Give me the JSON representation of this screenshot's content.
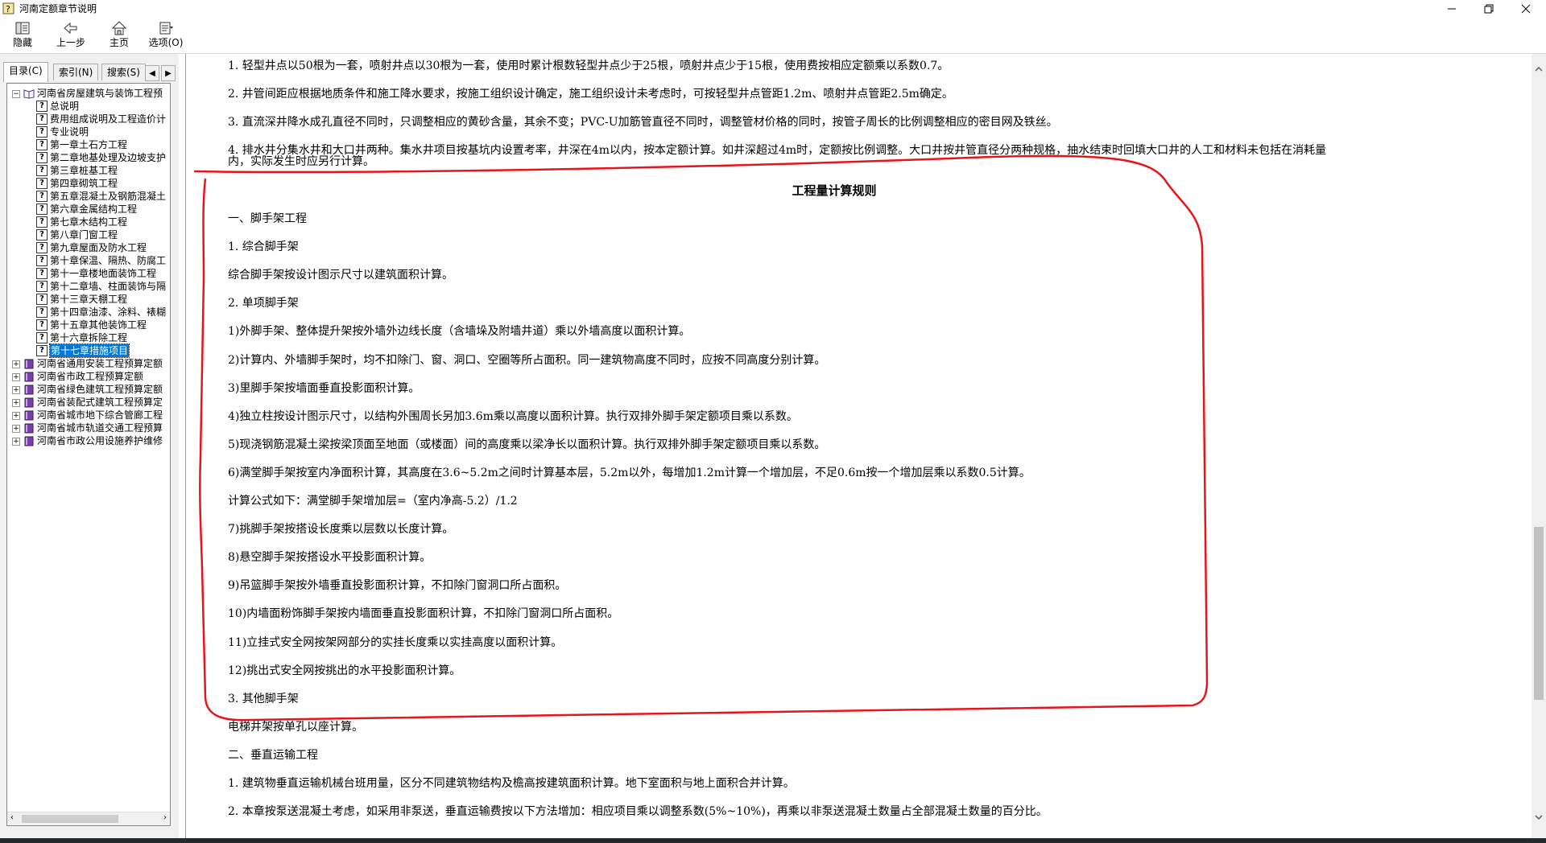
{
  "window": {
    "title": "河南定额章节说明"
  },
  "toolbar": {
    "hide": "隐藏",
    "back": "上一步",
    "home": "主页",
    "options": "选项(O)"
  },
  "tabs": {
    "contents": "目录(C)",
    "index": "索引(N)",
    "search": "搜索(S)"
  },
  "tree": {
    "root": "河南省房屋建筑与装饰工程预",
    "children": [
      "总说明",
      "费用组成说明及工程造价计",
      "专业说明",
      "第一章土石方工程",
      "第二章地基处理及边坡支护",
      "第三章桩基工程",
      "第四章砌筑工程",
      "第五章混凝土及钢筋混凝土",
      "第六章金属结构工程",
      "第七章木结构工程",
      "第八章门窗工程",
      "第九章屋面及防水工程",
      "第十章保温、隔热、防腐工",
      "第十一章楼地面装饰工程",
      "第十二章墙、柱面装饰与隔",
      "第十三章天棚工程",
      "第十四章油漆、涂料、裱糊",
      "第十五章其他装饰工程",
      "第十六章拆除工程",
      "第十七章措施项目"
    ],
    "selected_index": 19,
    "books": [
      "河南省通用安装工程预算定额",
      "河南省市政工程预算定额",
      "河南省绿色建筑工程预算定额",
      "河南省装配式建筑工程预算定",
      "河南省城市地下综合管廊工程",
      "河南省城市轨道交通工程预算",
      "河南省市政公用设施养护维修"
    ]
  },
  "content": {
    "top_items": [
      "1. 轻型井点以50根为一套，喷射井点以30根为一套，使用时累计根数轻型井点少于25根，喷射井点少于15根，使用费按相应定额乘以系数0.7。",
      "2. 井管间距应根据地质条件和施工降水要求，按施工组织设计确定，施工组织设计未考虑时，可按轻型井点管距1.2m、喷射井点管距2.5m确定。",
      "3. 直流深井降水成孔直径不同时，只调整相应的黄砂含量，其余不变；PVC-U加筋管直径不同时，调整管材价格的同时，按管子周长的比例调整相应的密目网及铁丝。"
    ],
    "item4_line1": "4. 排水井分集水井和大口井两种。集水井项目按基坑内设置考率，井深在4m以内，按本定额计算。如井深超过4m时，定额按比例调整。大口井按井管直径分两种规格，抽水结束时回填大口井的人工和材料未包括在消耗量",
    "item4_line2": "内，实际发生时应另行计算。",
    "section_title": "工程量计算规则",
    "lines": [
      "一、脚手架工程",
      "1. 综合脚手架",
      "综合脚手架按设计图示尺寸以建筑面积计算。",
      "2. 单项脚手架",
      "1)外脚手架、整体提升架按外墙外边线长度（含墙垛及附墙井道）乘以外墙高度以面积计算。",
      "2)计算内、外墙脚手架时，均不扣除门、窗、洞口、空圈等所占面积。同一建筑物高度不同时，应按不同高度分别计算。",
      "3)里脚手架按墙面垂直投影面积计算。",
      "4)独立柱按设计图示尺寸，以结构外围周长另加3.6m乘以高度以面积计算。执行双排外脚手架定额项目乘以系数。",
      "5)现浇钢筋混凝土梁按梁顶面至地面（或楼面）间的高度乘以梁净长以面积计算。执行双排外脚手架定额项目乘以系数。",
      "6)满堂脚手架按室内净面积计算，其高度在3.6~5.2m之间时计算基本层，5.2m以外，每增加1.2m计算一个增加层，不足0.6m按一个增加层乘以系数0.5计算。",
      "计算公式如下：满堂脚手架增加层=（室内净高-5.2）/1.2",
      "7)挑脚手架按搭设长度乘以层数以长度计算。",
      "8)悬空脚手架按搭设水平投影面积计算。",
      "9)吊篮脚手架按外墙垂直投影面积计算，不扣除门窗洞口所占面积。",
      "10)内墙面粉饰脚手架按内墙面垂直投影面积计算，不扣除门窗洞口所占面积。",
      "11)立挂式安全网按架网部分的实挂长度乘以实挂高度以面积计算。",
      "12)挑出式安全网按挑出的水平投影面积计算。",
      "3. 其他脚手架",
      "电梯井架按单孔以座计算。",
      "二、垂直运输工程",
      "1. 建筑物垂直运输机械台班用量，区分不同建筑物结构及檐高按建筑面积计算。地下室面积与地上面积合并计算。",
      "2. 本章按泵送混凝土考虑，如采用非泵送，垂直运输费按以下方法增加：相应项目乘以调整系数(5%~10%)，再乘以非泵送混凝土数量占全部混凝土数量的百分比。"
    ]
  },
  "colors": {
    "annotation": "#e8141c",
    "selection": "#0078d7"
  }
}
